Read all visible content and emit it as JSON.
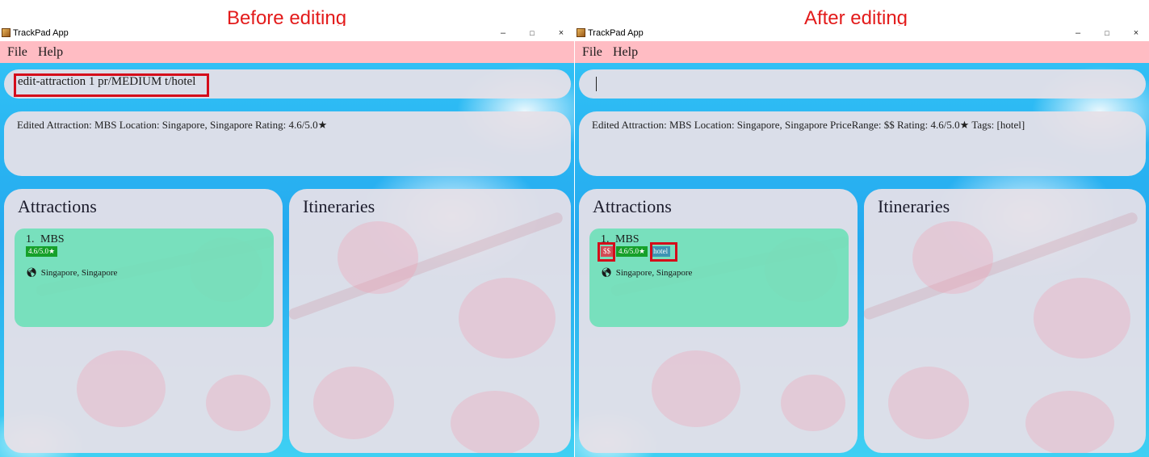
{
  "captions": {
    "before": "Before editing",
    "after": "After editing"
  },
  "windows": {
    "before": {
      "app_title": "TrackPad App",
      "controls": {
        "minimize": "–",
        "maximize": "□",
        "close": "×"
      },
      "menu": {
        "file": "File",
        "help": "Help"
      },
      "command": {
        "value": "edit-attraction 1 pr/MEDIUM t/hotel"
      },
      "result": {
        "text": "Edited Attraction: MBS Location: Singapore, Singapore Rating: 4.6/5.0★"
      },
      "attractions_title": "Attractions",
      "itineraries_title": "Itineraries",
      "attraction": {
        "index": "1.",
        "name": "MBS",
        "rating": "4.6/5.0★",
        "location": "Singapore, Singapore",
        "location_icon": "globe-icon"
      }
    },
    "after": {
      "app_title": "TrackPad App",
      "controls": {
        "minimize": "–",
        "maximize": "□",
        "close": "×"
      },
      "menu": {
        "file": "File",
        "help": "Help"
      },
      "command": {
        "value": ""
      },
      "result": {
        "text": "Edited Attraction: MBS Location: Singapore, Singapore PriceRange: $$ Rating: 4.6/5.0★ Tags: [hotel]"
      },
      "attractions_title": "Attractions",
      "itineraries_title": "Itineraries",
      "attraction": {
        "index": "1.",
        "name": "MBS",
        "price": "$$",
        "rating": "4.6/5.0★",
        "tag": "hotel",
        "location": "Singapore, Singapore",
        "location_icon": "globe-icon"
      }
    }
  },
  "colors": {
    "caption": "#e31b1b",
    "menubar": "#ffbcc3",
    "card": "#70e0b8",
    "rating_badge": "#16a02a",
    "price_badge": "#d34a55",
    "tag_badge": "#3d94b3",
    "highlight_box": "#d40c1a"
  }
}
